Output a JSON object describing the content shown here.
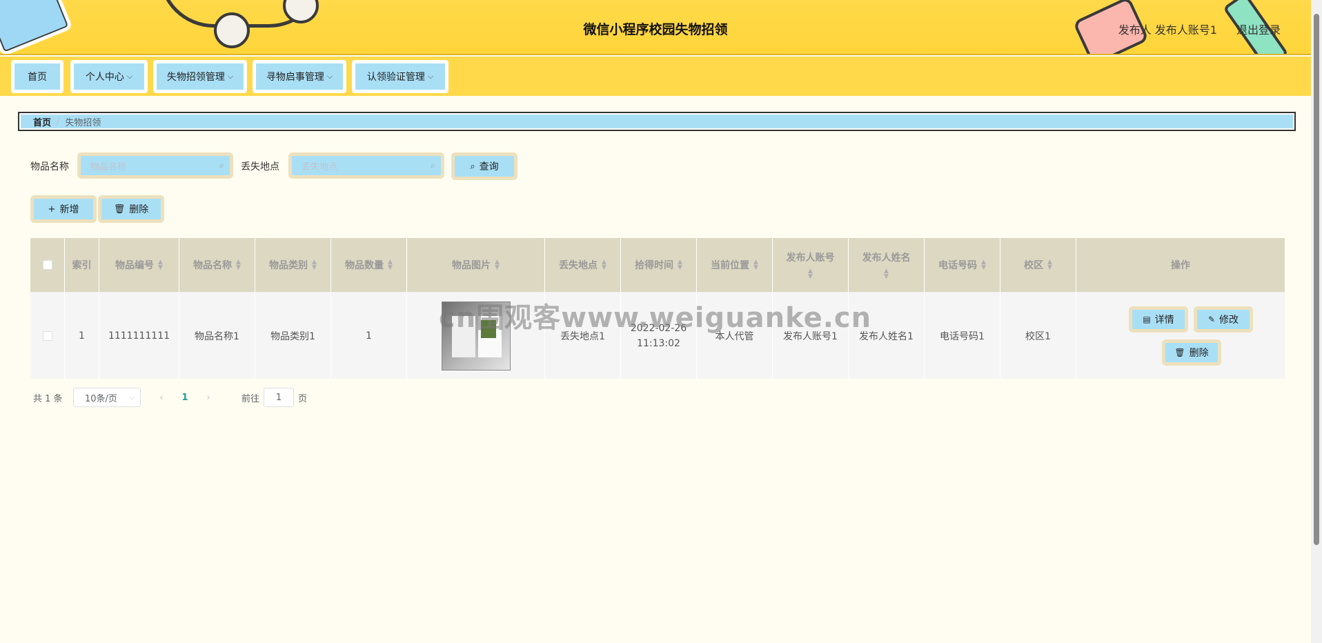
{
  "header": {
    "title": "微信小程序校园失物招领",
    "user_text": "发布人 发布人账号1",
    "logout": "退出登录"
  },
  "nav": {
    "items": [
      {
        "label": "首页",
        "dropdown": false
      },
      {
        "label": "个人中心",
        "dropdown": true
      },
      {
        "label": "失物招领管理",
        "dropdown": true
      },
      {
        "label": "寻物启事管理",
        "dropdown": true
      },
      {
        "label": "认领验证管理",
        "dropdown": true
      }
    ]
  },
  "breadcrumb": {
    "home": "首页",
    "current": "失物招领"
  },
  "search": {
    "name_label": "物品名称",
    "name_placeholder": "物品名称",
    "place_label": "丢失地点",
    "place_placeholder": "丢失地点",
    "query_button": "查询"
  },
  "actions": {
    "add": "新增",
    "delete": "删除"
  },
  "table": {
    "columns": [
      "索引",
      "物品编号",
      "物品名称",
      "物品类别",
      "物品数量",
      "物品图片",
      "丢失地点",
      "拾得时间",
      "当前位置",
      "发布人账号",
      "发布人姓名",
      "电话号码",
      "校区",
      "操作"
    ],
    "rows": [
      {
        "index": "1",
        "code": "1111111111",
        "name": "物品名称1",
        "category": "物品类别1",
        "quantity": "1",
        "place": "丢失地点1",
        "time_date": "2022-02-26",
        "time_clock": "11:13:02",
        "position": "本人代管",
        "account": "发布人账号1",
        "publisher": "发布人姓名1",
        "phone": "电话号码1",
        "campus": "校区1"
      }
    ],
    "row_actions": {
      "detail": "详情",
      "edit": "修改",
      "delete": "删除"
    }
  },
  "watermark": "cn围观客www.weiguanke.cn",
  "pagination": {
    "total": "共 1 条",
    "page_size": "10条/页",
    "current_page": "1",
    "goto_label": "前往",
    "goto_value": "1",
    "page_suffix": "页"
  },
  "colors": {
    "header_bg": "#ffd94a",
    "button_bg": "#a9dff5",
    "button_border": "#ede0bd",
    "page_bg": "#fffdf1",
    "table_header_bg": "#ddd8c2"
  }
}
